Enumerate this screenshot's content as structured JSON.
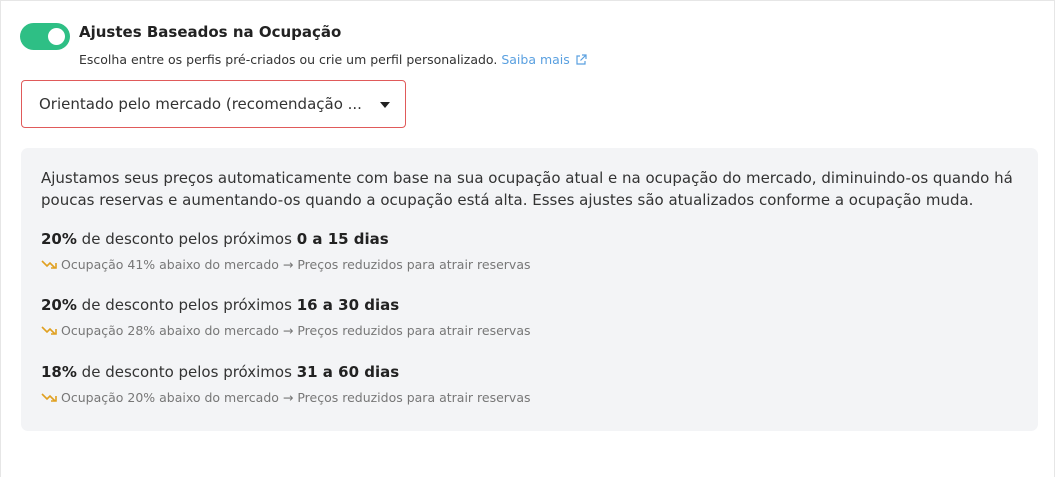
{
  "header": {
    "toggle_on": true,
    "title": "Ajustes Baseados na Ocupação",
    "subtitle": "Escolha entre os perfis pré-criados ou crie um perfil personalizado.",
    "learn_more": "Saiba mais",
    "link_icon": "external-link-icon"
  },
  "profile_select": {
    "value": "Orientado pelo mercado (recomendação ..."
  },
  "info": {
    "description": "Ajustamos seus preços automaticamente com base na sua ocupação atual e na ocupação do mercado, diminuindo-os quando há poucas reservas e aumentando-os quando a ocupação está alta. Esses ajustes são atualizados conforme a ocupação muda.",
    "rules": [
      {
        "discount": "20%",
        "middle_text": " de desconto pelos próximos ",
        "range": "0 a 15 dias",
        "detail": "Ocupação 41% abaixo do mercado → Preços reduzidos para atrair reservas"
      },
      {
        "discount": "20%",
        "middle_text": " de desconto pelos próximos ",
        "range": "16 a 30 dias",
        "detail": "Ocupação 28% abaixo do mercado → Preços reduzidos para atrair reservas"
      },
      {
        "discount": "18%",
        "middle_text": " de desconto pelos próximos ",
        "range": "31 a 60 dias",
        "detail": "Ocupação 20% abaixo do mercado → Preços reduzidos para atrair reservas"
      }
    ]
  },
  "colors": {
    "toggle": "#2ebf85",
    "link": "#5aa0e0",
    "select_border": "#e05a5a",
    "trend_icon": "#e0a020",
    "info_background": "#f3f4f6"
  },
  "icons": {
    "trend": "trending-down-icon",
    "caret": "caret-down-icon"
  }
}
